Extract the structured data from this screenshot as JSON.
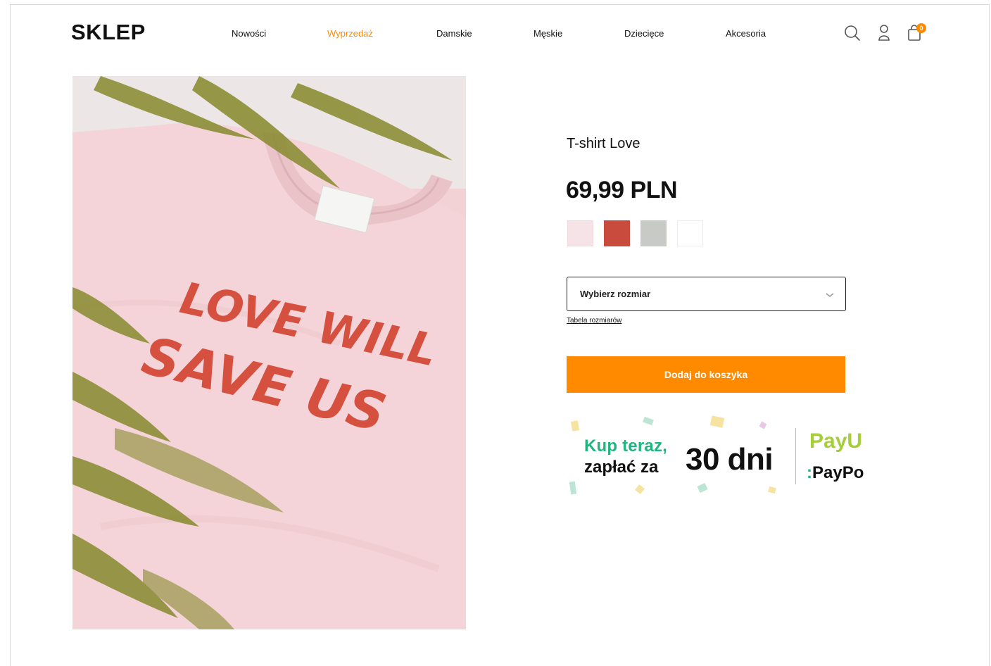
{
  "header": {
    "logo": "SKLEP",
    "nav": [
      {
        "label": "Nowości",
        "id": "nowosci"
      },
      {
        "label": "Wyprzedaż",
        "id": "wyprzedaz",
        "highlight": true
      },
      {
        "label": "Damskie",
        "id": "damskie"
      },
      {
        "label": "Męskie",
        "id": "meskie"
      },
      {
        "label": "Dziecięce",
        "id": "dzieciece"
      },
      {
        "label": "Akcesoria",
        "id": "akcesoria"
      }
    ],
    "icons": [
      "search-icon",
      "user-icon",
      "cart-icon"
    ],
    "cart_count": "0"
  },
  "product": {
    "image_text_line1": "LOVE WILL",
    "image_text_line2": "SAVE US",
    "name": "T-shirt Love",
    "price": "69,99 PLN",
    "swatches": [
      "#f6e3e8",
      "#c94b3d",
      "#c8cbc5",
      "#ffffff"
    ],
    "size_select": {
      "label": "Wybierz rozmiar"
    },
    "size_table_link": "Tabela rozmiarów",
    "add_to_cart": "Dodaj do koszyka"
  },
  "payment_banner": {
    "line1": "Kup teraz,",
    "line2": "zapłać za",
    "days": "30 dni",
    "payu": "PayU",
    "paypo": "PayPo"
  },
  "colors": {
    "accent": "#ff8a00",
    "green": "#1fb57f",
    "payu_green": "#a6ce39",
    "tshirt_pink": "#f3d2d6",
    "print_red": "#d6503f"
  }
}
